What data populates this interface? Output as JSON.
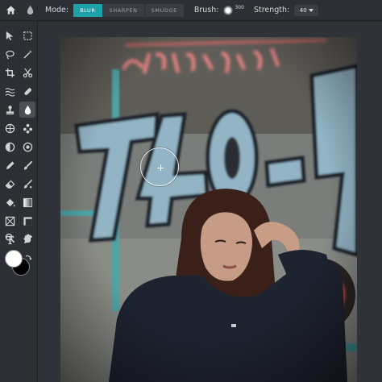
{
  "options_bar": {
    "home_icon": "home-icon",
    "tool_icon": "blur-drop-icon",
    "mode_label": "Mode:",
    "modes": [
      "BLUR",
      "SHARPEN",
      "SMUDGE"
    ],
    "active_mode": "BLUR",
    "brush_label": "Brush:",
    "brush_size": "300",
    "strength_label": "Strength:",
    "strength_value": "40",
    "accent_color": "#1da1a8"
  },
  "toolbar": {
    "tools": [
      {
        "name": "move-icon"
      },
      {
        "name": "marquee-icon"
      },
      {
        "name": "lasso-icon"
      },
      {
        "name": "magic-wand-icon"
      },
      {
        "name": "crop-icon"
      },
      {
        "name": "scissors-icon"
      },
      {
        "name": "liquify-icon"
      },
      {
        "name": "healing-icon"
      },
      {
        "name": "clone-stamp-icon"
      },
      {
        "name": "blur-drop-icon",
        "active": true
      },
      {
        "name": "sponge-icon"
      },
      {
        "name": "color-replace-icon"
      },
      {
        "name": "dodge-icon"
      },
      {
        "name": "burn-icon"
      },
      {
        "name": "pencil-icon"
      },
      {
        "name": "brush-icon"
      },
      {
        "name": "eraser-icon"
      },
      {
        "name": "pattern-brush-icon"
      },
      {
        "name": "paint-bucket-icon"
      },
      {
        "name": "gradient-icon"
      },
      {
        "name": "shape-icon"
      },
      {
        "name": "rectangle-shape-icon"
      },
      {
        "name": "text-icon"
      },
      {
        "name": "eyedropper-icon"
      },
      {
        "name": "zoom-icon"
      },
      {
        "name": "hand-icon"
      }
    ],
    "foreground_color": "#ffffff",
    "background_color": "#000000",
    "swap_icon": "swap-colors-icon"
  }
}
